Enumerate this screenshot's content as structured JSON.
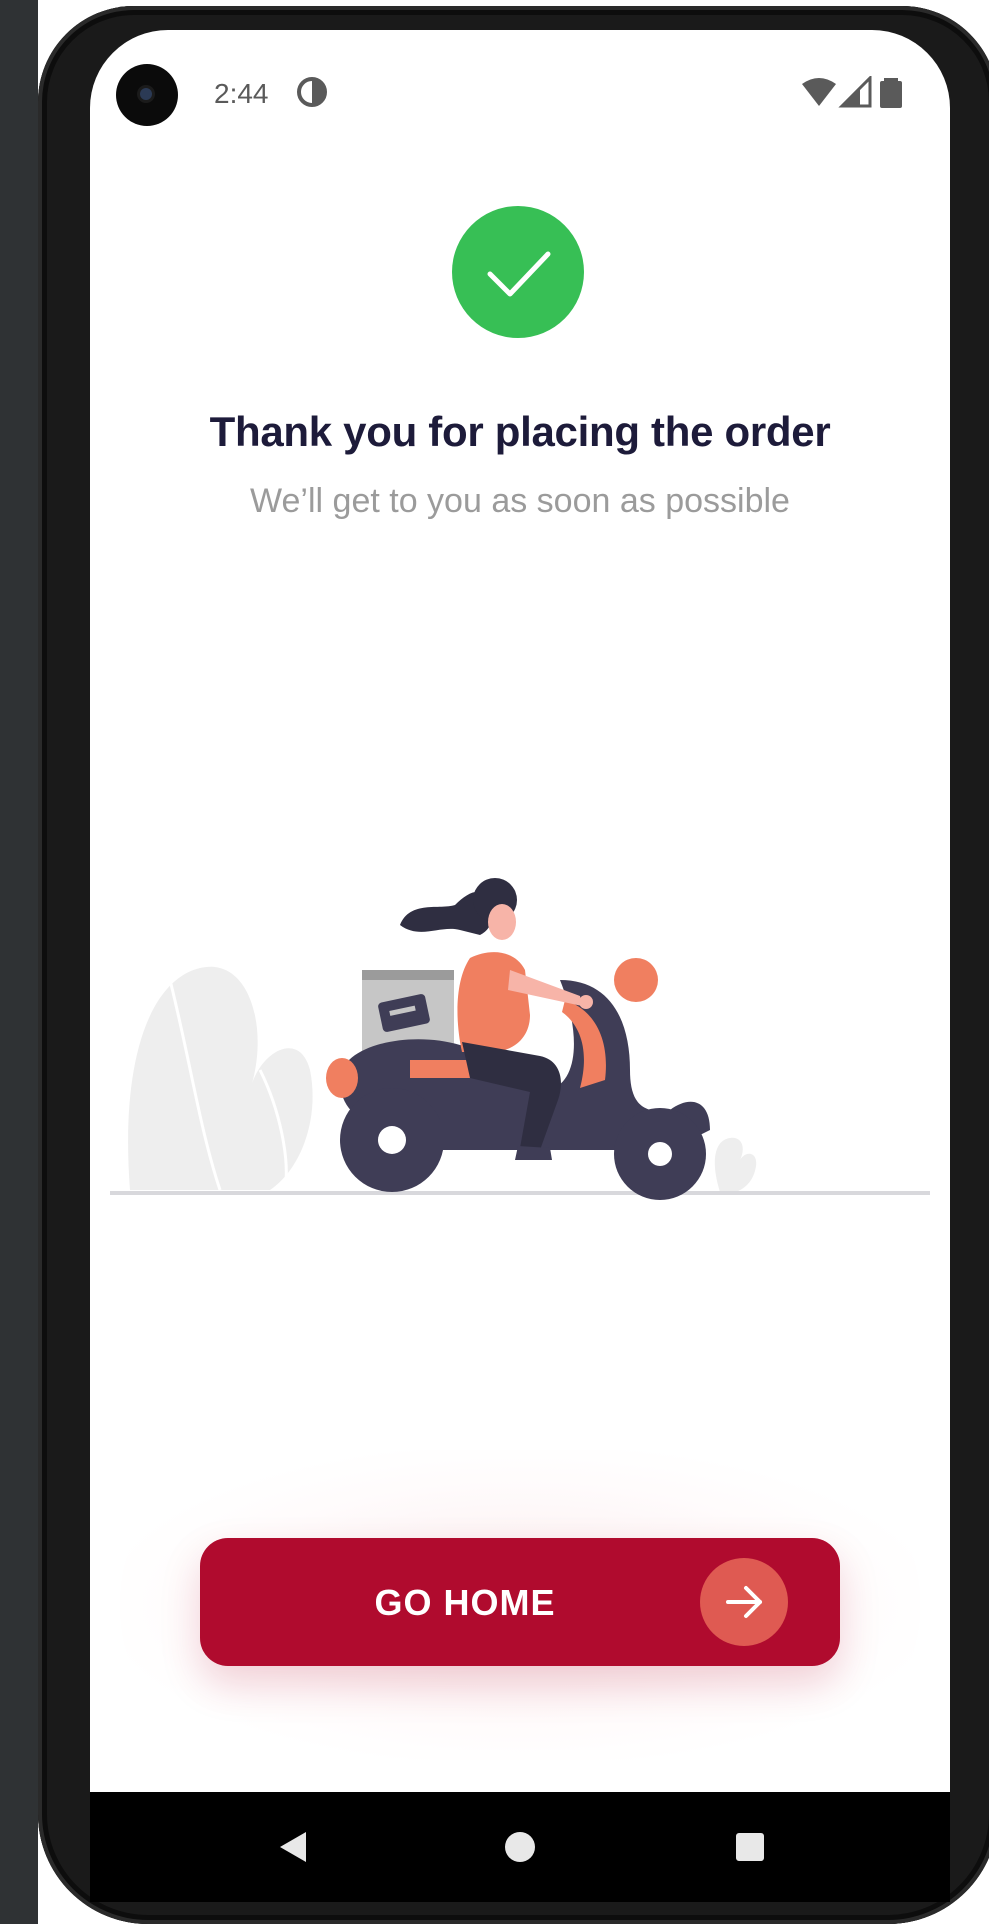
{
  "status_bar": {
    "time": "2:44",
    "icons": [
      "camera-icon",
      "data-saver-icon",
      "wifi-icon",
      "signal-icon",
      "battery-icon"
    ]
  },
  "confirmation": {
    "icon": "check-circle-icon",
    "title": "Thank you for placing the order",
    "subtitle": "We’ll get to you as soon as possible"
  },
  "illustration": {
    "description_icon": "delivery-scooter-illustration"
  },
  "action": {
    "label": "GO HOME",
    "icon": "arrow-right-icon"
  },
  "nav_bar": {
    "icons": [
      "back-icon",
      "home-icon",
      "recents-icon"
    ]
  },
  "colors": {
    "success": "#37bf55",
    "primary": "#b00b2e",
    "accent": "#df5a52",
    "title": "#1d1b3a",
    "subtitle": "#9b9b9b"
  }
}
